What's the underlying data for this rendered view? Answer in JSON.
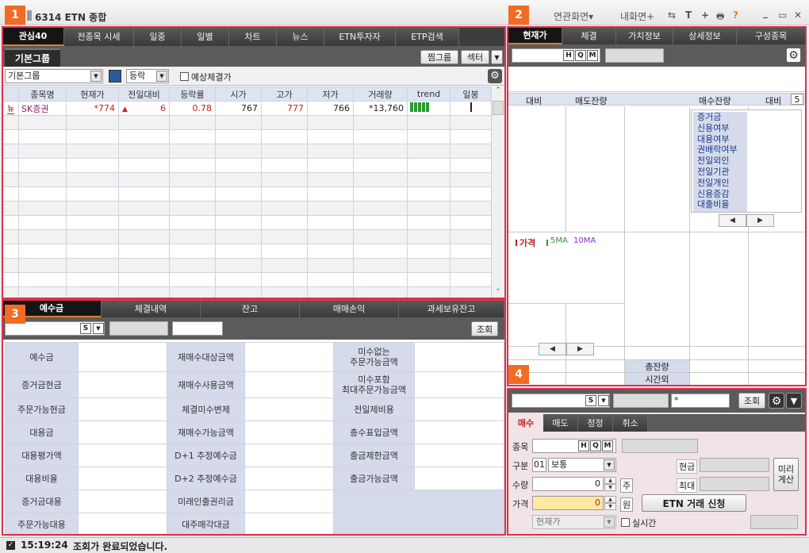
{
  "window": {
    "title": "6314  ETN 종합",
    "menu": [
      "연관화면▾",
      "내화면+"
    ],
    "tools": [
      "⇆",
      "T",
      "+",
      "🖶",
      "?"
    ],
    "controls": [
      "_",
      "▭",
      "✕"
    ]
  },
  "markers": [
    "1",
    "2",
    "3",
    "4"
  ],
  "watch": {
    "tabs": [
      "관심40",
      "전종목 시세",
      "일중",
      "일별",
      "차트",
      "뉴스",
      "ETN투자자",
      "ETP검색"
    ],
    "group_tab": "기본그룹",
    "buttons": {
      "favorites": "찜그룹",
      "sector": "섹터"
    },
    "group_select": "기본그룹",
    "sort_select": "등락",
    "expected_label": "예상체결가",
    "columns": [
      "종목명",
      "현재가",
      "전일대비",
      "등락률",
      "시가",
      "고가",
      "저가",
      "거래량",
      "trend",
      "일봉"
    ],
    "rows": [
      {
        "flag": "뉴",
        "name": "SK증권",
        "price": "*774",
        "arrow": "▲",
        "change": "6",
        "rate": "0.78",
        "open": "767",
        "high": "777",
        "low": "766",
        "volume": "*13,760"
      }
    ]
  },
  "price": {
    "tabs": [
      "현재가",
      "체결",
      "가치정보",
      "상세정보",
      "구성종목"
    ],
    "hq": [
      "H",
      "Q",
      "M"
    ],
    "orderbook_headers": [
      "대비",
      "매도잔량",
      "",
      "매수잔량",
      "대비"
    ],
    "depth_count": "5",
    "info_list": [
      "증거금",
      "신용여부",
      "대용여부",
      "권배락여부",
      "전일외인",
      "전일기관",
      "전일개인",
      "신용증감",
      "대출비율"
    ],
    "legend": {
      "price": "가격",
      "ma5": "5MA",
      "ma10": "10MA"
    },
    "total_label": "총잔량",
    "afterhours_label": "시간외"
  },
  "account": {
    "tabs": [
      "예수금",
      "체결내역",
      "잔고",
      "매매손익",
      "과세보유잔고"
    ],
    "s_label": "S",
    "query_button": "조회",
    "grid": [
      [
        "예수금",
        "재매수대상금액",
        "미수없는\n주문가능금액"
      ],
      [
        "증거금현금",
        "재매수사용금액",
        "미수포함\n최대주문가능금액"
      ],
      [
        "주문가능현금",
        "체결미수변제",
        "전일제비용"
      ],
      [
        "대용금",
        "재매수가능금액",
        "총수표입금액"
      ],
      [
        "대용평가액",
        "D+1 추정예수금",
        "출금제한금액"
      ],
      [
        "대용비율",
        "D+2 추정예수금",
        "출금가능금액"
      ],
      [
        "증거금대용",
        "미래인출권리금",
        ""
      ],
      [
        "주문가능대용",
        "대주매각대금",
        ""
      ]
    ]
  },
  "order": {
    "s_label": "S",
    "password_value": "*",
    "query_button": "조회",
    "tabs": [
      "매수",
      "매도",
      "정정",
      "취소"
    ],
    "labels": {
      "code": "종목",
      "type": "구분",
      "qty": "수량",
      "price": "가격",
      "cash": "현금",
      "max": "최대",
      "share_unit": "주",
      "won_unit": "원",
      "realtime": "실시간"
    },
    "type_code": "01",
    "type_value": "보통",
    "qty_value": "0",
    "price_value": "0",
    "price_type": "현재가",
    "calc_button": "미리\n계산",
    "submit_button": "ETN 거래 신청"
  },
  "status": {
    "time": "15:19:24",
    "message": "조회가 완료되었습니다."
  },
  "colors": {
    "accent": "#e0304a",
    "marker": "#f26b22",
    "up": "#d81b2a",
    "header": "#dde3f0"
  }
}
